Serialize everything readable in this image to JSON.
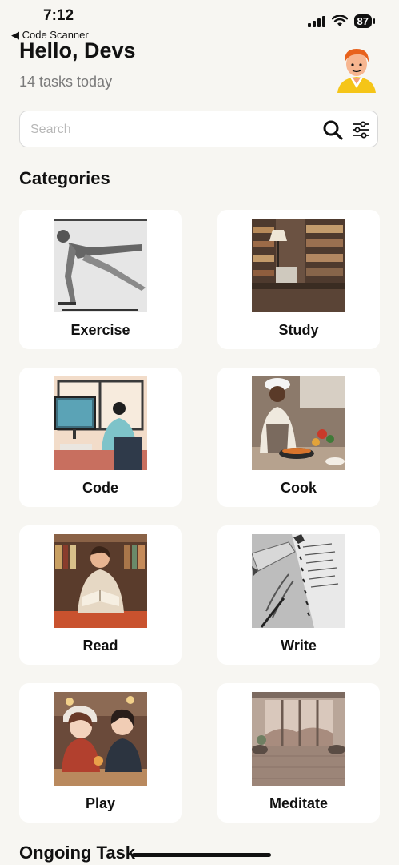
{
  "status_bar": {
    "time": "7:12",
    "back_label": "◀ Code Scanner",
    "battery": "87"
  },
  "header": {
    "greeting": "Hello, Devs",
    "subtitle": "14 tasks today"
  },
  "search": {
    "placeholder": "Search",
    "value": "",
    "search_icon": "search-icon",
    "filter_icon": "sliders-icon"
  },
  "categories": {
    "title": "Categories",
    "items": [
      {
        "label": "Exercise"
      },
      {
        "label": "Study"
      },
      {
        "label": "Code"
      },
      {
        "label": "Cook"
      },
      {
        "label": "Read"
      },
      {
        "label": "Write"
      },
      {
        "label": "Play"
      },
      {
        "label": "Meditate"
      }
    ]
  },
  "ongoing": {
    "title": "Ongoing Task"
  },
  "colors": {
    "background": "#F7F6F2",
    "card": "#FFFFFF",
    "text": "#111111",
    "muted": "#7A7A7A"
  }
}
